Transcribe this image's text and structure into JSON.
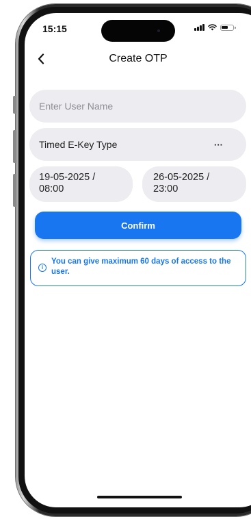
{
  "status_bar": {
    "time": "15:15"
  },
  "header": {
    "title": "Create OTP",
    "back_icon": "chevron-left-icon"
  },
  "form": {
    "username": {
      "value": "",
      "placeholder": "Enter User Name"
    },
    "key_type": {
      "selected": "Timed E-Key Type",
      "more_icon": "···"
    },
    "start_date": {
      "date": "19-05-2025 /",
      "time": "08:00"
    },
    "end_date": {
      "date": "26-05-2025 /",
      "time": "23:00"
    },
    "confirm_label": "Confirm"
  },
  "info": {
    "icon": "info-icon",
    "message": "You can give maximum 60 days of access to the user."
  },
  "colors": {
    "accent": "#1776f0",
    "field_bg": "#ececf1",
    "text": "#111111",
    "placeholder": "#8e8e95"
  }
}
